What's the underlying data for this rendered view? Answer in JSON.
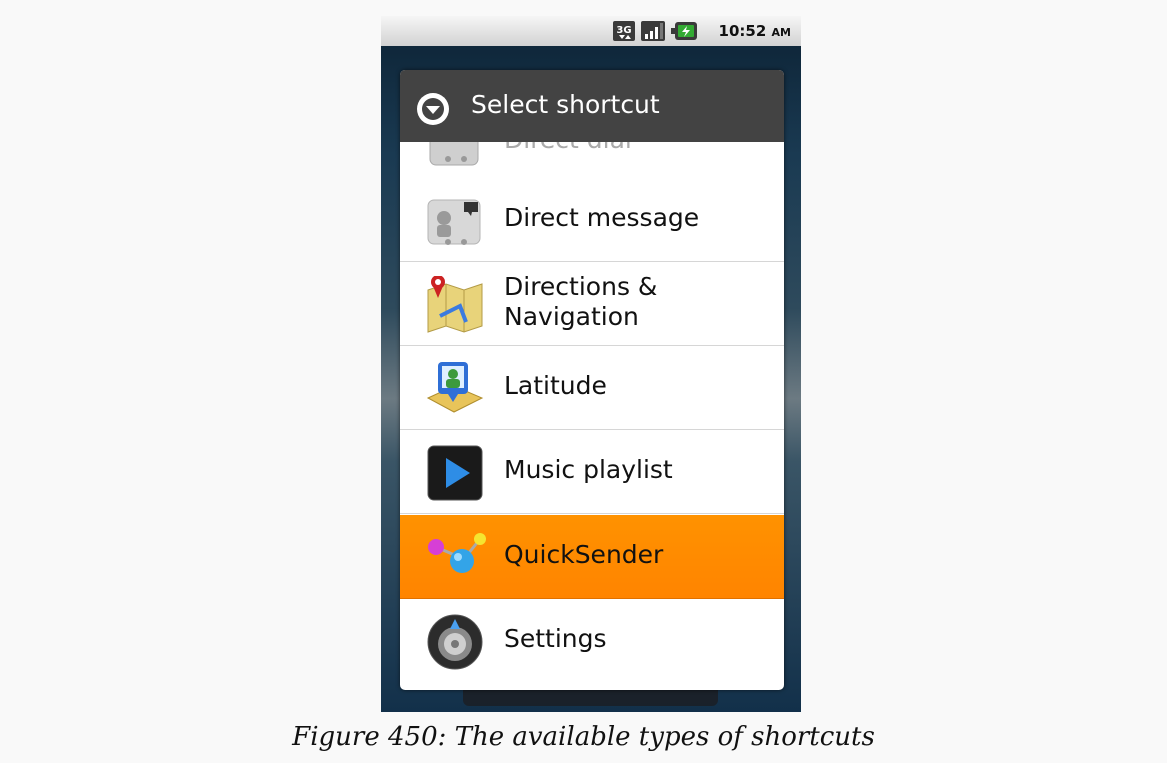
{
  "status_bar": {
    "network_icon": "3g-icon",
    "signal_icon": "signal-bars-icon",
    "battery_icon": "battery-charging-icon",
    "time": "10:52",
    "ampm": "AM"
  },
  "dialog": {
    "title": "Select shortcut",
    "title_icon": "dropdown-circle-icon",
    "items": [
      {
        "label": "Direct dial",
        "icon": "direct-dial-icon",
        "selected": false
      },
      {
        "label": "Direct message",
        "icon": "direct-message-icon",
        "selected": false
      },
      {
        "label": "Directions &\nNavigation",
        "icon": "directions-navigation-icon",
        "selected": false
      },
      {
        "label": "Latitude",
        "icon": "latitude-icon",
        "selected": false
      },
      {
        "label": "Music playlist",
        "icon": "music-playlist-icon",
        "selected": false
      },
      {
        "label": "QuickSender",
        "icon": "quicksender-icon",
        "selected": true
      },
      {
        "label": "Settings",
        "icon": "settings-icon",
        "selected": false
      }
    ]
  },
  "caption": "Figure 450: The available types of shortcuts",
  "colors": {
    "selected": "#ff8a00",
    "header": "#434343"
  }
}
